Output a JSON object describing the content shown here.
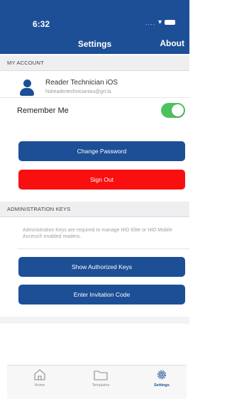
{
  "status_bar": {
    "time": "6:32",
    "signal": "....",
    "wifi": "▾"
  },
  "nav": {
    "title": "Settings",
    "about": "About"
  },
  "my_account": {
    "header": "MY ACCOUNT",
    "name": "Reader Technician iOS",
    "email": "hidreadertechnicianios@grt.la",
    "remember_me": {
      "label": "Remember Me",
      "on": true
    },
    "change_password": "Change Password",
    "sign_out": "Sign Out"
  },
  "administration": {
    "header": "ADMINISTRATION KEYS",
    "note": "Administration Keys are required to manage HID Elite or HID Mobile Access® enabled readers.",
    "show_keys": "Show Authorized Keys",
    "invitation": "Enter Invitation Code"
  },
  "tabs": [
    {
      "label": "Home",
      "icon": "home-icon",
      "active": false
    },
    {
      "label": "Templates",
      "icon": "folder-icon",
      "active": false
    },
    {
      "label": "Settings",
      "icon": "gear-icon",
      "active": true
    }
  ],
  "colors": {
    "primary": "#1d4f96",
    "danger": "#f90f0f",
    "toggle_on": "#4cc25f"
  }
}
